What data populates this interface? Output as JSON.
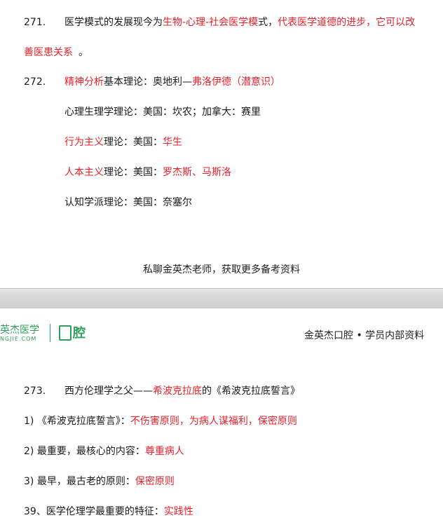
{
  "page1": {
    "item271": {
      "num": "271.",
      "t1": "医学模式的发展现今为",
      "t2": "生物-心理-社会医学模",
      "t3": "式，",
      "t4": "代表医学道德的进步，它可以改",
      "t5": "善医患关系",
      "t6": "。"
    },
    "item272": {
      "num": "272.",
      "r1a": "精神分析",
      "r1b": "基本理论：奥地利—",
      "r1c": "弗洛伊德（潜意识）",
      "r2": "心理生理学理论：美国：坎农；加拿大：赛里",
      "r3a": "行为主义",
      "r3b": "理论：美国：",
      "r3c": "华生",
      "r4a": "人本主义",
      "r4b": "理论：美国：",
      "r4c": "罗杰斯、马斯洛",
      "r5": "认知学派理论：美国：奈塞尔"
    },
    "promo": "私聊金英杰老师，获取更多备考资料"
  },
  "header": {
    "logo_cn": "英杰医学",
    "logo_en": "NGJIE.COM",
    "logo_word": "腔",
    "right": "金英杰口腔 • 学员内部资料"
  },
  "page2": {
    "item273": {
      "num": "273.",
      "a": "西方伦理学之父——",
      "b": "希波克拉底",
      "c": "的《希波克拉底誓言》"
    },
    "l1a": "1) 《希波克拉底誓言》：",
    "l1b": "不伤害原则，为病人谋福利，保密原则",
    "l2a": "2) 最重要，最核心的内容：",
    "l2b": "尊重病人",
    "l3a": "3) 最早，最古老的原则：",
    "l3b": "保密原则",
    "l4a": "39、医学伦理学最重要的特征：",
    "l4b": "实践性"
  }
}
